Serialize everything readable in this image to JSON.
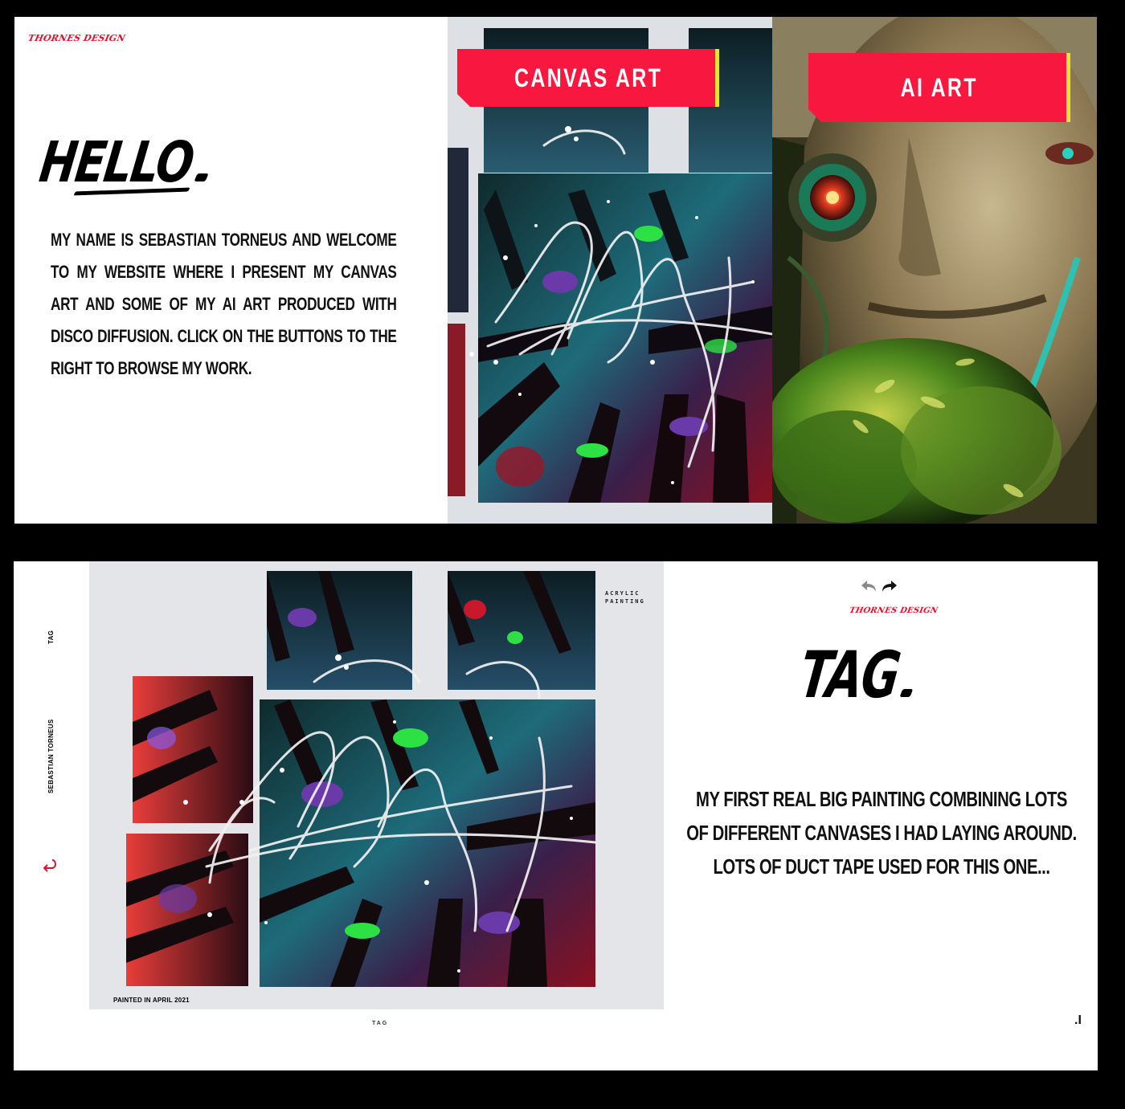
{
  "top": {
    "brand": "THORNES DESIGN",
    "title": "HELLO",
    "intro": "MY NAME IS SEBASTIAN TORNEUS AND WELCOME TO MY WEBSITE WHERE I PRESENT MY CANVAS ART AND SOME OF MY AI ART PRODUCED WITH DISCO DIFFUSION. CLICK ON THE BUTTONS TO THE RIGHT TO BROWSE MY WORK.",
    "canvas_button": "CANVAS ART",
    "ai_button": "AI ART"
  },
  "bottom": {
    "side_tag": "TAG",
    "side_author": "SEBASTIAN TORNEUS",
    "brand": "THORNES DESIGN",
    "title": "TAG",
    "description": "MY FIRST REAL BIG PAINTING COMBINING LOTS OF DIFFERENT CANVASES I HAD LAYING AROUND. LOTS OF DUCT TAPE USED FOR THIS ONE...",
    "caption": "PAINTED IN APRIL 2021",
    "acrylic_label": "ACRYLIC PAINTING",
    "footer_label": "TAG",
    "page_indicator": ".I"
  },
  "colors": {
    "accent": "#f8173e",
    "accent_stripe": "#e8e334",
    "brand_red": "#e2102e",
    "background": "#000000",
    "panel": "#ffffff"
  },
  "icons": {
    "back": "return-arrow-icon",
    "undo": "undo-arrow-icon",
    "redo": "redo-arrow-icon"
  }
}
